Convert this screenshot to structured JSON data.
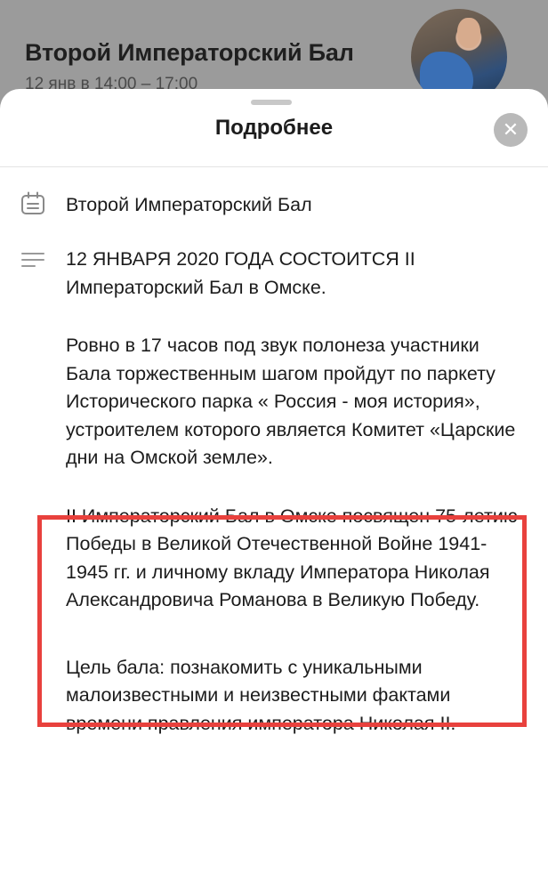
{
  "background": {
    "event_title": "Второй Императорский Бал",
    "event_time": "12 янв в 14:00 – 17:00"
  },
  "sheet": {
    "title": "Подробнее",
    "close_icon": "close-icon",
    "name_icon": "calendar-icon",
    "name": "Второй Императорский Бал",
    "description_icon": "text-lines-icon",
    "description": [
      "12 ЯНВАРЯ 2020 ГОДА СОСТОИТСЯ II Императорский Бал в Омске.",
      "Ровно в 17 часов под звук полонеза участники Бала торжественным шагом пройдут по паркету Исторического парка « Россия - моя история», устроителем которого является  Комитет «Царские дни на Омской земле».",
      "II Императорский Бал в Омске посвящен 75-летию Победы в Великой Отечественной Войне 1941-1945 гг. и личному вкладу Императора Николая Александровича Романова в Великую Победу.",
      "Цель бала: познакомить с уникальными малоизвестными и неизвестными фактами времени правления императора Николая II."
    ]
  },
  "colors": {
    "highlight_border": "#e8413d",
    "close_button_bg": "#b9b9b9"
  }
}
